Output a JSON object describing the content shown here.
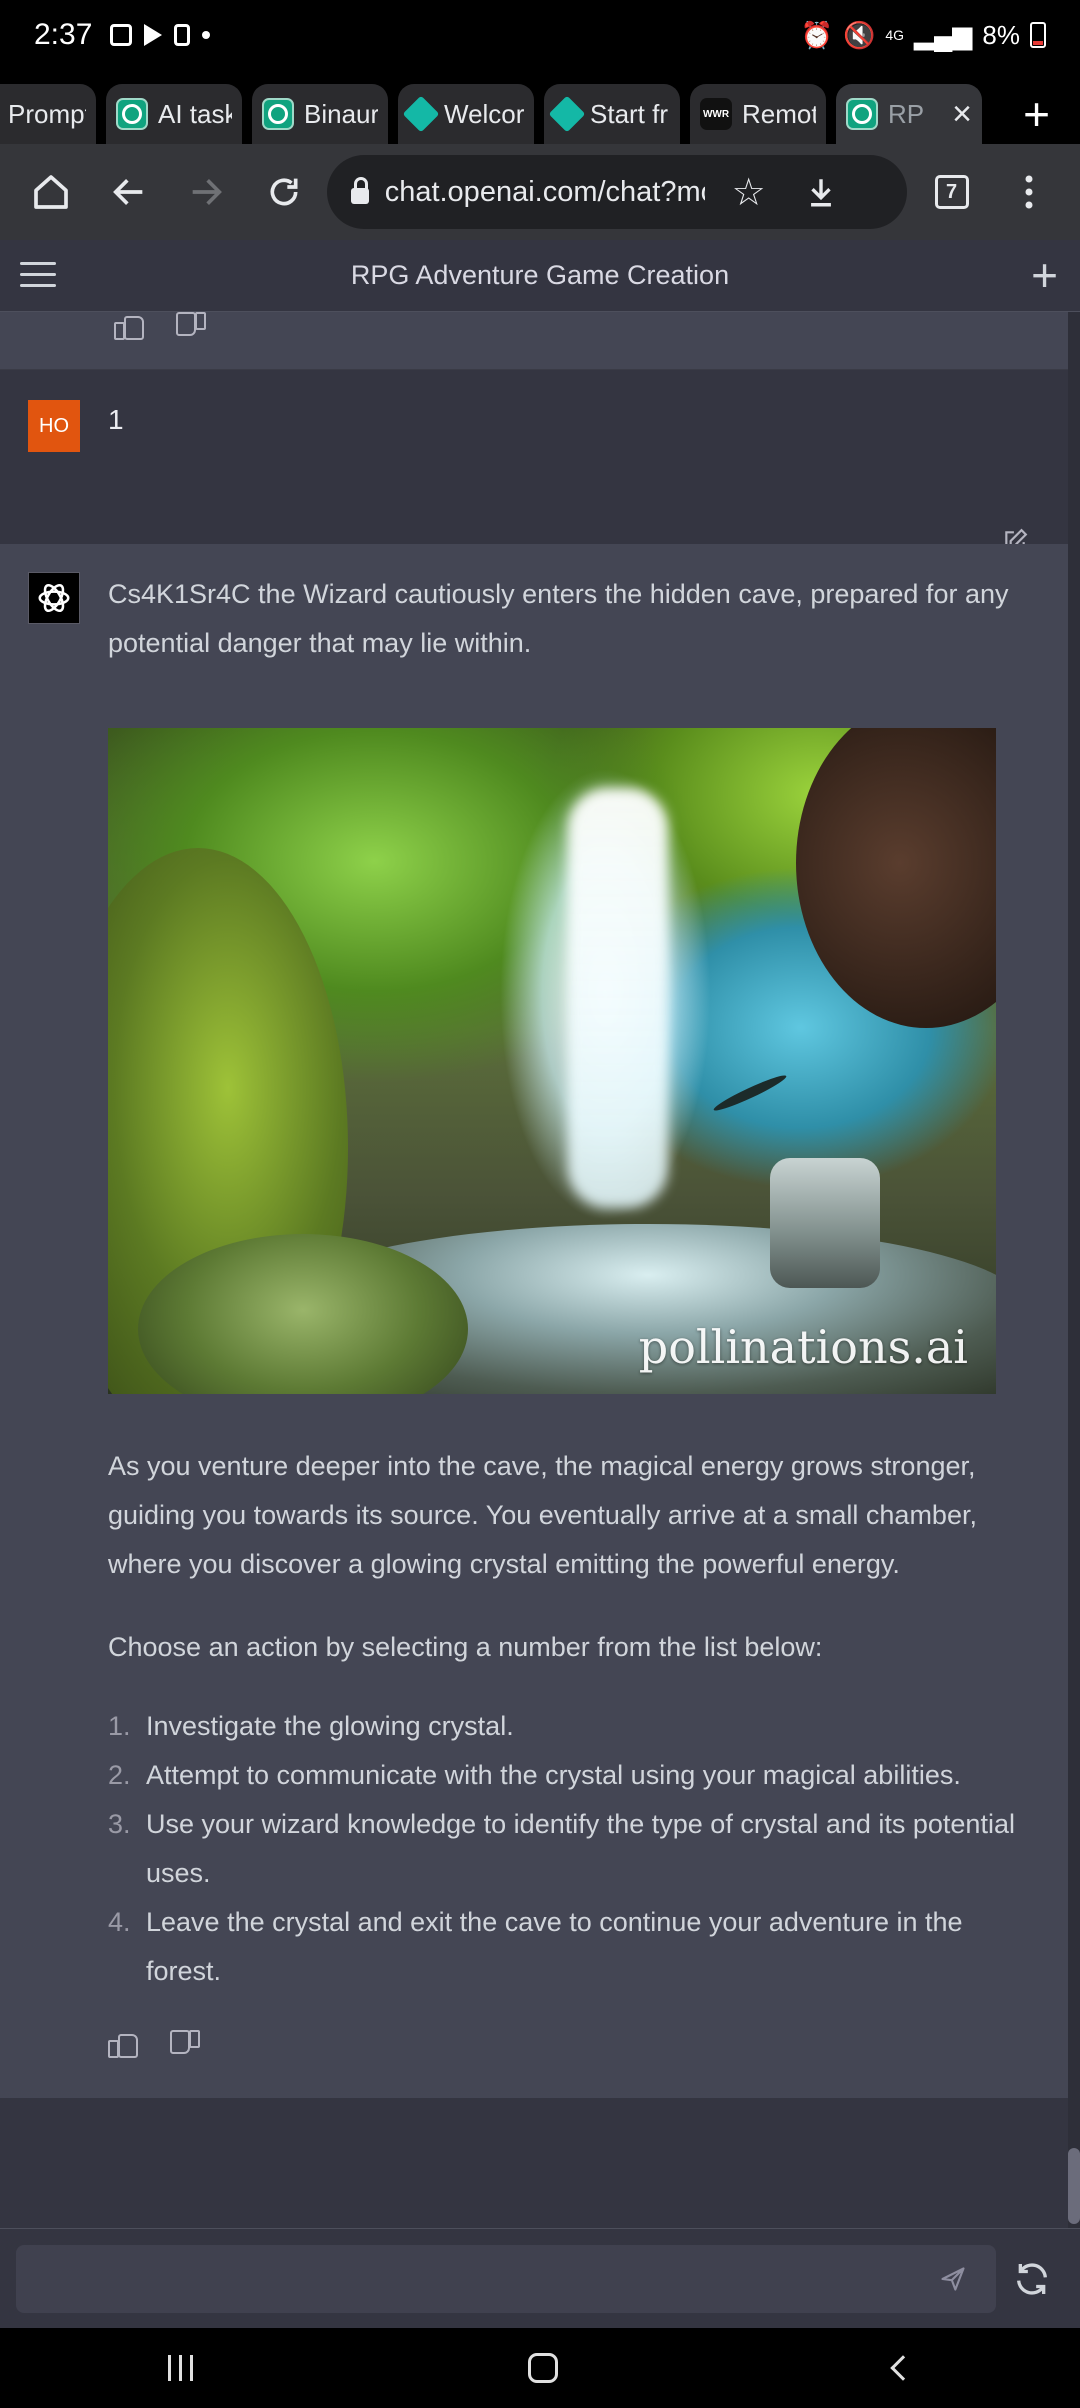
{
  "status": {
    "time": "2:37",
    "battery": "8%",
    "network": "4G"
  },
  "tabs": [
    {
      "label": "Prompt",
      "favicon": "none"
    },
    {
      "label": "AI task",
      "favicon": "openai-icon"
    },
    {
      "label": "Binaura",
      "favicon": "openai-icon"
    },
    {
      "label": "Welcor",
      "favicon": "diamond-icon"
    },
    {
      "label": "Start fr",
      "favicon": "diamond-icon"
    },
    {
      "label": "Remote",
      "favicon": "wwr-icon"
    },
    {
      "label": "RP",
      "favicon": "openai-icon",
      "active": true
    }
  ],
  "toolbar": {
    "url": "chat.openai.com/chat?mo",
    "tab_count": "7"
  },
  "chat": {
    "title": "RPG Adventure Game Creation"
  },
  "user_message": {
    "avatar": "HO",
    "text": "1"
  },
  "bot_message": {
    "intro": "Cs4K1Sr4C the Wizard cautiously enters the hidden cave, prepared for any potential danger that may lie within.",
    "image_watermark": "pollinations.ai",
    "narration": "As you venture deeper into the cave, the magical energy grows stronger, guiding you towards its source. You eventually arrive at a small chamber, where you discover a glowing crystal emitting the powerful energy.",
    "prompt": "Choose an action by selecting a number from the list below:",
    "options": [
      {
        "num": "1.",
        "text": "Investigate the glowing crystal."
      },
      {
        "num": "2.",
        "text": "Attempt to communicate with the crystal using your magical abilities."
      },
      {
        "num": "3.",
        "text": "Use your wizard knowledge to identify the type of crystal and its potential uses."
      },
      {
        "num": "4.",
        "text": "Leave the crystal and exit the cave to continue your adventure in the forest."
      }
    ]
  },
  "colors": {
    "background": "#343541",
    "bot_background": "#444654",
    "user_avatar": "#e1550f",
    "text": "#d1d5db"
  }
}
